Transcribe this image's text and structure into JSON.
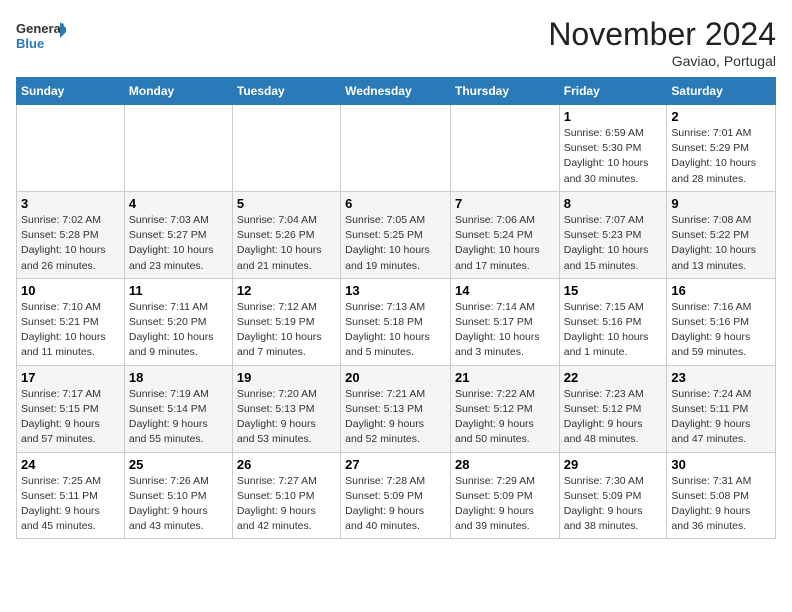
{
  "logo": {
    "line1": "General",
    "line2": "Blue"
  },
  "title": "November 2024",
  "location": "Gaviao, Portugal",
  "weekdays": [
    "Sunday",
    "Monday",
    "Tuesday",
    "Wednesday",
    "Thursday",
    "Friday",
    "Saturday"
  ],
  "weeks": [
    [
      {
        "day": "",
        "info": ""
      },
      {
        "day": "",
        "info": ""
      },
      {
        "day": "",
        "info": ""
      },
      {
        "day": "",
        "info": ""
      },
      {
        "day": "",
        "info": ""
      },
      {
        "day": "1",
        "info": "Sunrise: 6:59 AM\nSunset: 5:30 PM\nDaylight: 10 hours\nand 30 minutes."
      },
      {
        "day": "2",
        "info": "Sunrise: 7:01 AM\nSunset: 5:29 PM\nDaylight: 10 hours\nand 28 minutes."
      }
    ],
    [
      {
        "day": "3",
        "info": "Sunrise: 7:02 AM\nSunset: 5:28 PM\nDaylight: 10 hours\nand 26 minutes."
      },
      {
        "day": "4",
        "info": "Sunrise: 7:03 AM\nSunset: 5:27 PM\nDaylight: 10 hours\nand 23 minutes."
      },
      {
        "day": "5",
        "info": "Sunrise: 7:04 AM\nSunset: 5:26 PM\nDaylight: 10 hours\nand 21 minutes."
      },
      {
        "day": "6",
        "info": "Sunrise: 7:05 AM\nSunset: 5:25 PM\nDaylight: 10 hours\nand 19 minutes."
      },
      {
        "day": "7",
        "info": "Sunrise: 7:06 AM\nSunset: 5:24 PM\nDaylight: 10 hours\nand 17 minutes."
      },
      {
        "day": "8",
        "info": "Sunrise: 7:07 AM\nSunset: 5:23 PM\nDaylight: 10 hours\nand 15 minutes."
      },
      {
        "day": "9",
        "info": "Sunrise: 7:08 AM\nSunset: 5:22 PM\nDaylight: 10 hours\nand 13 minutes."
      }
    ],
    [
      {
        "day": "10",
        "info": "Sunrise: 7:10 AM\nSunset: 5:21 PM\nDaylight: 10 hours\nand 11 minutes."
      },
      {
        "day": "11",
        "info": "Sunrise: 7:11 AM\nSunset: 5:20 PM\nDaylight: 10 hours\nand 9 minutes."
      },
      {
        "day": "12",
        "info": "Sunrise: 7:12 AM\nSunset: 5:19 PM\nDaylight: 10 hours\nand 7 minutes."
      },
      {
        "day": "13",
        "info": "Sunrise: 7:13 AM\nSunset: 5:18 PM\nDaylight: 10 hours\nand 5 minutes."
      },
      {
        "day": "14",
        "info": "Sunrise: 7:14 AM\nSunset: 5:17 PM\nDaylight: 10 hours\nand 3 minutes."
      },
      {
        "day": "15",
        "info": "Sunrise: 7:15 AM\nSunset: 5:16 PM\nDaylight: 10 hours\nand 1 minute."
      },
      {
        "day": "16",
        "info": "Sunrise: 7:16 AM\nSunset: 5:16 PM\nDaylight: 9 hours\nand 59 minutes."
      }
    ],
    [
      {
        "day": "17",
        "info": "Sunrise: 7:17 AM\nSunset: 5:15 PM\nDaylight: 9 hours\nand 57 minutes."
      },
      {
        "day": "18",
        "info": "Sunrise: 7:19 AM\nSunset: 5:14 PM\nDaylight: 9 hours\nand 55 minutes."
      },
      {
        "day": "19",
        "info": "Sunrise: 7:20 AM\nSunset: 5:13 PM\nDaylight: 9 hours\nand 53 minutes."
      },
      {
        "day": "20",
        "info": "Sunrise: 7:21 AM\nSunset: 5:13 PM\nDaylight: 9 hours\nand 52 minutes."
      },
      {
        "day": "21",
        "info": "Sunrise: 7:22 AM\nSunset: 5:12 PM\nDaylight: 9 hours\nand 50 minutes."
      },
      {
        "day": "22",
        "info": "Sunrise: 7:23 AM\nSunset: 5:12 PM\nDaylight: 9 hours\nand 48 minutes."
      },
      {
        "day": "23",
        "info": "Sunrise: 7:24 AM\nSunset: 5:11 PM\nDaylight: 9 hours\nand 47 minutes."
      }
    ],
    [
      {
        "day": "24",
        "info": "Sunrise: 7:25 AM\nSunset: 5:11 PM\nDaylight: 9 hours\nand 45 minutes."
      },
      {
        "day": "25",
        "info": "Sunrise: 7:26 AM\nSunset: 5:10 PM\nDaylight: 9 hours\nand 43 minutes."
      },
      {
        "day": "26",
        "info": "Sunrise: 7:27 AM\nSunset: 5:10 PM\nDaylight: 9 hours\nand 42 minutes."
      },
      {
        "day": "27",
        "info": "Sunrise: 7:28 AM\nSunset: 5:09 PM\nDaylight: 9 hours\nand 40 minutes."
      },
      {
        "day": "28",
        "info": "Sunrise: 7:29 AM\nSunset: 5:09 PM\nDaylight: 9 hours\nand 39 minutes."
      },
      {
        "day": "29",
        "info": "Sunrise: 7:30 AM\nSunset: 5:09 PM\nDaylight: 9 hours\nand 38 minutes."
      },
      {
        "day": "30",
        "info": "Sunrise: 7:31 AM\nSunset: 5:08 PM\nDaylight: 9 hours\nand 36 minutes."
      }
    ]
  ]
}
